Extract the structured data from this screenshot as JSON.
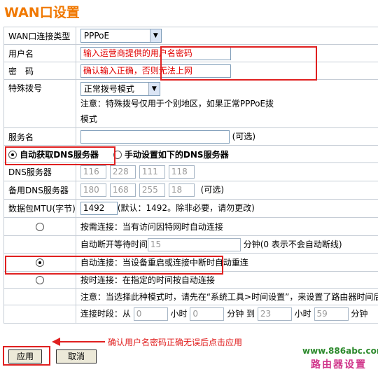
{
  "page_title": "WAN口设置",
  "rows": {
    "conn_type": {
      "label": "WAN口连接类型",
      "value": "PPPoE"
    },
    "username": {
      "label": "用户名",
      "hint": "输入运营商提供的用户名密码"
    },
    "password": {
      "label": "密　码",
      "hint": "确认输入正确，否则无法上网"
    },
    "special_dial": {
      "label": "特殊拨号",
      "value": "正常拨号模式",
      "note_line1": "注意：特殊拨号仅用于个别地区，如果正常PPPoE拨",
      "note_line2": "模式"
    },
    "service_name": {
      "label": "服务名",
      "suffix": "(可选)"
    },
    "dns_auto": {
      "label": "自动获取DNS服务器"
    },
    "dns_manual": {
      "label": "手动设置如下的DNS服务器"
    },
    "dns_primary": {
      "label": "DNS服务器",
      "octets": [
        "116",
        "228",
        "111",
        "118"
      ]
    },
    "dns_secondary": {
      "label": "备用DNS服务器",
      "octets": [
        "180",
        "168",
        "255",
        "18"
      ],
      "suffix": "(可选)"
    },
    "mtu": {
      "label": "数据包MTU(字节)",
      "value": "1492",
      "note": "(默认：1492。除非必要，请勿更改)"
    },
    "on_demand": {
      "label": "按需连接：当有访问因特网时自动连接",
      "idle_label": "自动断开等待时间",
      "idle_value": "15",
      "idle_suffix": "分钟(0 表示不会自动断线)"
    },
    "auto_connect": {
      "label": "自动连接：当设备重启或连接中断时自动重连"
    },
    "timed": {
      "label": "按时连接：在指定的时间按自动连接",
      "note": "注意：当选择此种模式时，请先在“系统工具>时间设置”，来设置了路由器时间后,",
      "period_label": "连接时段：从",
      "from_h": "0",
      "hour1": "小时",
      "from_m": "0",
      "min1": "分钟 到",
      "to_h": "23",
      "hour2": "小时",
      "to_m": "59",
      "min2": "分钟"
    }
  },
  "buttons": {
    "apply": "应用",
    "cancel": "取消"
  },
  "annotation": "确认用户名密码正确无误后点击应用",
  "watermark": {
    "line1": "www.886abc.com",
    "line2": "路由器设置"
  },
  "colors": {
    "title": "#f07800",
    "highlight": "#e02020",
    "watermark_url": "#2d8a2d",
    "watermark_text": "#d0348a"
  }
}
